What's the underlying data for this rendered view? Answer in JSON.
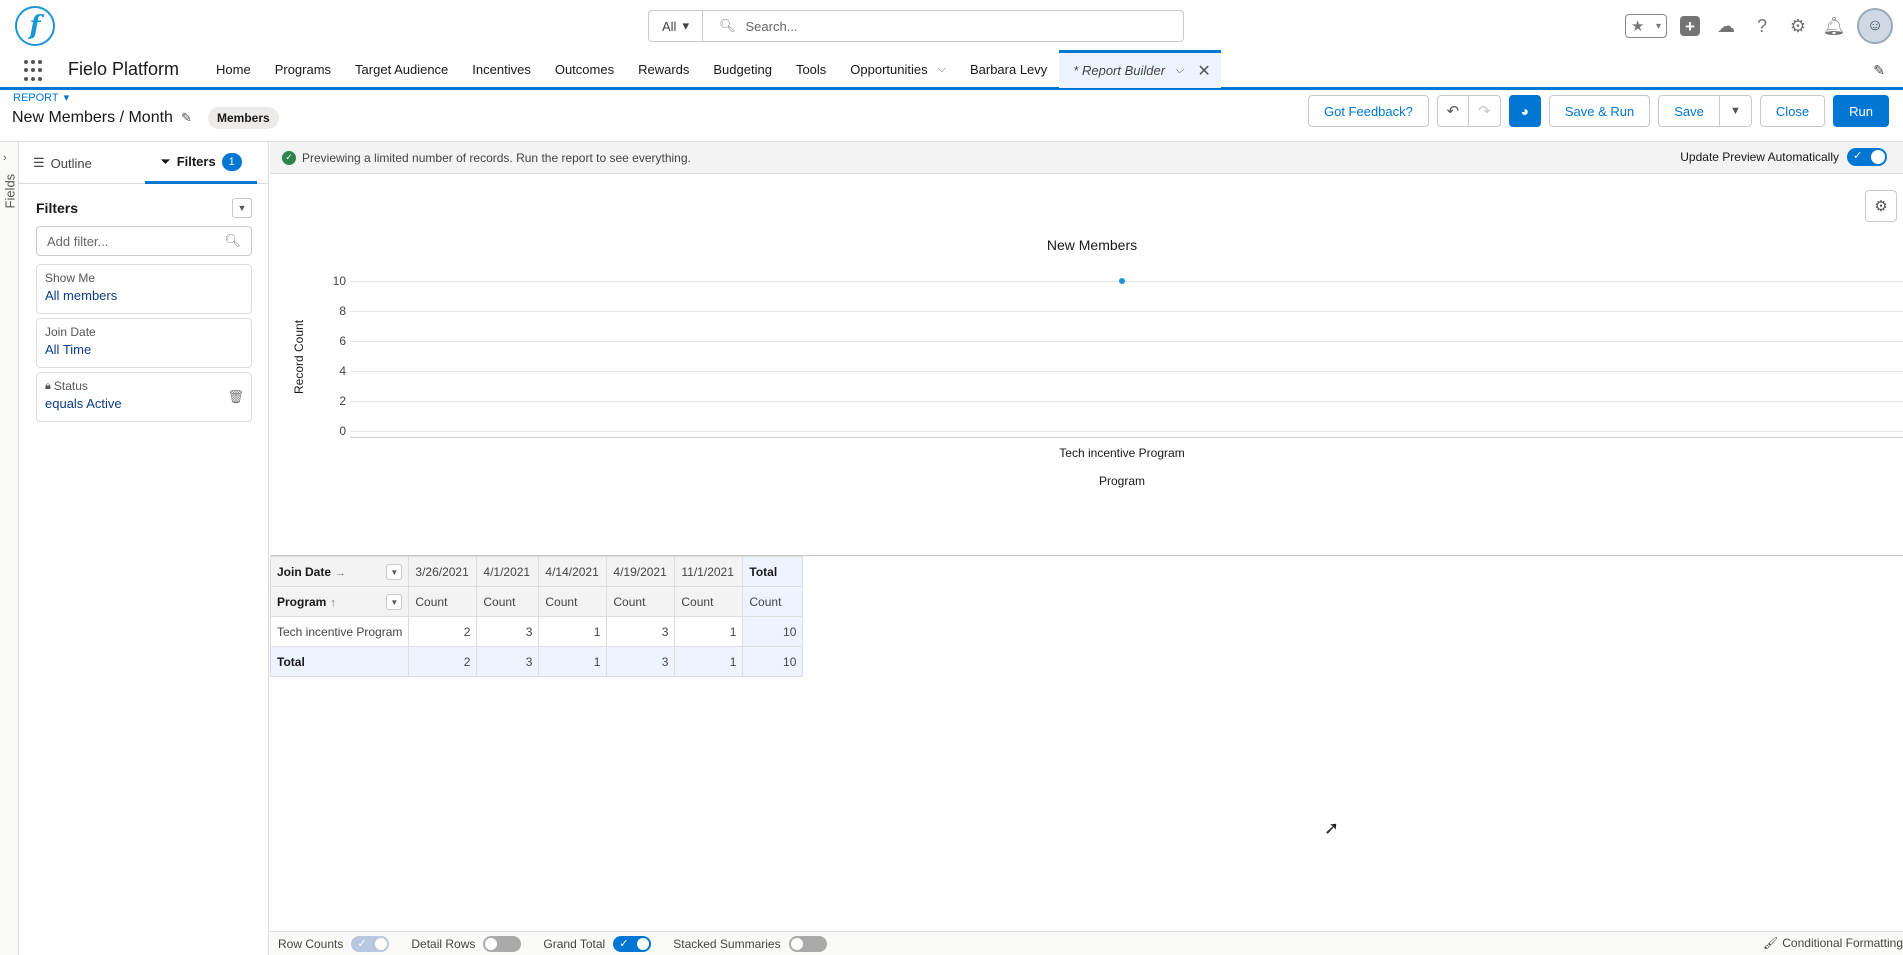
{
  "header": {
    "search_scope": "All",
    "search_placeholder": "Search..."
  },
  "nav": {
    "app_name": "Fielo Platform",
    "items": [
      {
        "label": "Home"
      },
      {
        "label": "Programs"
      },
      {
        "label": "Target Audience"
      },
      {
        "label": "Incentives"
      },
      {
        "label": "Outcomes"
      },
      {
        "label": "Rewards"
      },
      {
        "label": "Budgeting"
      },
      {
        "label": "Tools"
      },
      {
        "label": "Opportunities"
      },
      {
        "label": "Barbara Levy"
      }
    ],
    "active_tab": "* Report Builder"
  },
  "report": {
    "type_label": "REPORT",
    "title": "New Members / Month",
    "badge": "Members",
    "buttons": {
      "feedback": "Got Feedback?",
      "save_run": "Save & Run",
      "save": "Save",
      "close": "Close",
      "run": "Run"
    }
  },
  "fields_rail": {
    "label": "Fields"
  },
  "panel": {
    "tab_outline": "Outline",
    "tab_filters": "Filters",
    "filter_count": "1",
    "filters_heading": "Filters",
    "add_filter_placeholder": "Add filter...",
    "filters": [
      {
        "label": "Show Me",
        "value": "All members"
      },
      {
        "label": "Join Date",
        "value": "All Time"
      },
      {
        "label": "Status",
        "value": "equals Active",
        "locked": true
      }
    ]
  },
  "preview": {
    "message": "Previewing a limited number of records. Run the report to see everything.",
    "auto_update_label": "Update Preview Automatically"
  },
  "chart_data": {
    "type": "scatter",
    "title": "New Members",
    "xlabel": "Program",
    "ylabel": "Record Count",
    "categories": [
      "Tech incentive Program"
    ],
    "values": [
      10
    ],
    "yticks": [
      "10",
      "8",
      "6",
      "4",
      "2",
      "0"
    ],
    "ylim": [
      0,
      10
    ],
    "grid": true,
    "point_color": "#1b96d3"
  },
  "table": {
    "col_group_label": "Join Date",
    "row_group_label": "Program",
    "columns": [
      "3/26/2021",
      "4/1/2021",
      "4/14/2021",
      "4/19/2021",
      "11/1/2021"
    ],
    "total_label": "Total",
    "metric_label": "Count",
    "rows": [
      {
        "label": "Tech incentive Program",
        "values": [
          "2",
          "3",
          "1",
          "3",
          "1"
        ],
        "total": "10"
      }
    ],
    "grand_total": {
      "label": "Total",
      "values": [
        "2",
        "3",
        "1",
        "3",
        "1"
      ],
      "total": "10"
    }
  },
  "footer": {
    "row_counts": "Row Counts",
    "detail_rows": "Detail Rows",
    "grand_total": "Grand Total",
    "stacked_summaries": "Stacked Summaries",
    "conditional_formatting": "Conditional Formatting"
  },
  "colors": {
    "brand": "#0176d3",
    "success": "#2e844a"
  }
}
